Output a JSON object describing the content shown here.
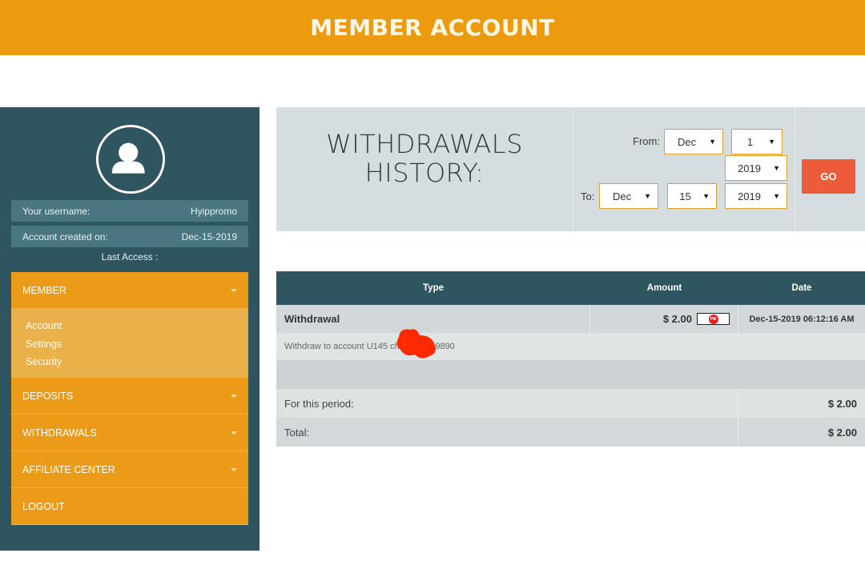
{
  "header": {
    "title": "MEMBER ACCOUNT"
  },
  "sidebar": {
    "username_label": "Your username:",
    "username_value": "Hyippromo",
    "created_label": "Account created on:",
    "created_value": "Dec-15-2019",
    "last_access_label": "Last Access :",
    "menu": {
      "member": "MEMBER",
      "member_sub": [
        "Account",
        "Settings",
        "Security"
      ],
      "deposits": "DEPOSITS",
      "withdrawals": "WITHDRAWALS",
      "affiliate": "AFFILIATE CENTER",
      "logout": "LOGOUT"
    }
  },
  "filter": {
    "title_line1": "WITHDRAWALS",
    "title_line2": "HISTORY:",
    "from_label": "From:",
    "to_label": "To:",
    "from_month": "Dec",
    "from_day": "1",
    "from_year": "2019",
    "to_month": "Dec",
    "to_day": "15",
    "to_year": "2019",
    "go_label": "GO"
  },
  "table": {
    "columns": [
      "Type",
      "Amount",
      "Date"
    ],
    "row": {
      "type": "Withdrawal",
      "amount": "$ 2.00",
      "processor_badge": "PM",
      "date": "Dec-15-2019 06:12:16 AM",
      "description": "Withdraw to account U145          ch is 293959890"
    },
    "period_label": "For this period:",
    "period_value": "$ 2.00",
    "total_label": "Total:",
    "total_value": "$ 2.00"
  },
  "colors": {
    "accent": "#ec9b0f",
    "sidebar": "#2f5660",
    "go_button": "#ec5b3a"
  }
}
